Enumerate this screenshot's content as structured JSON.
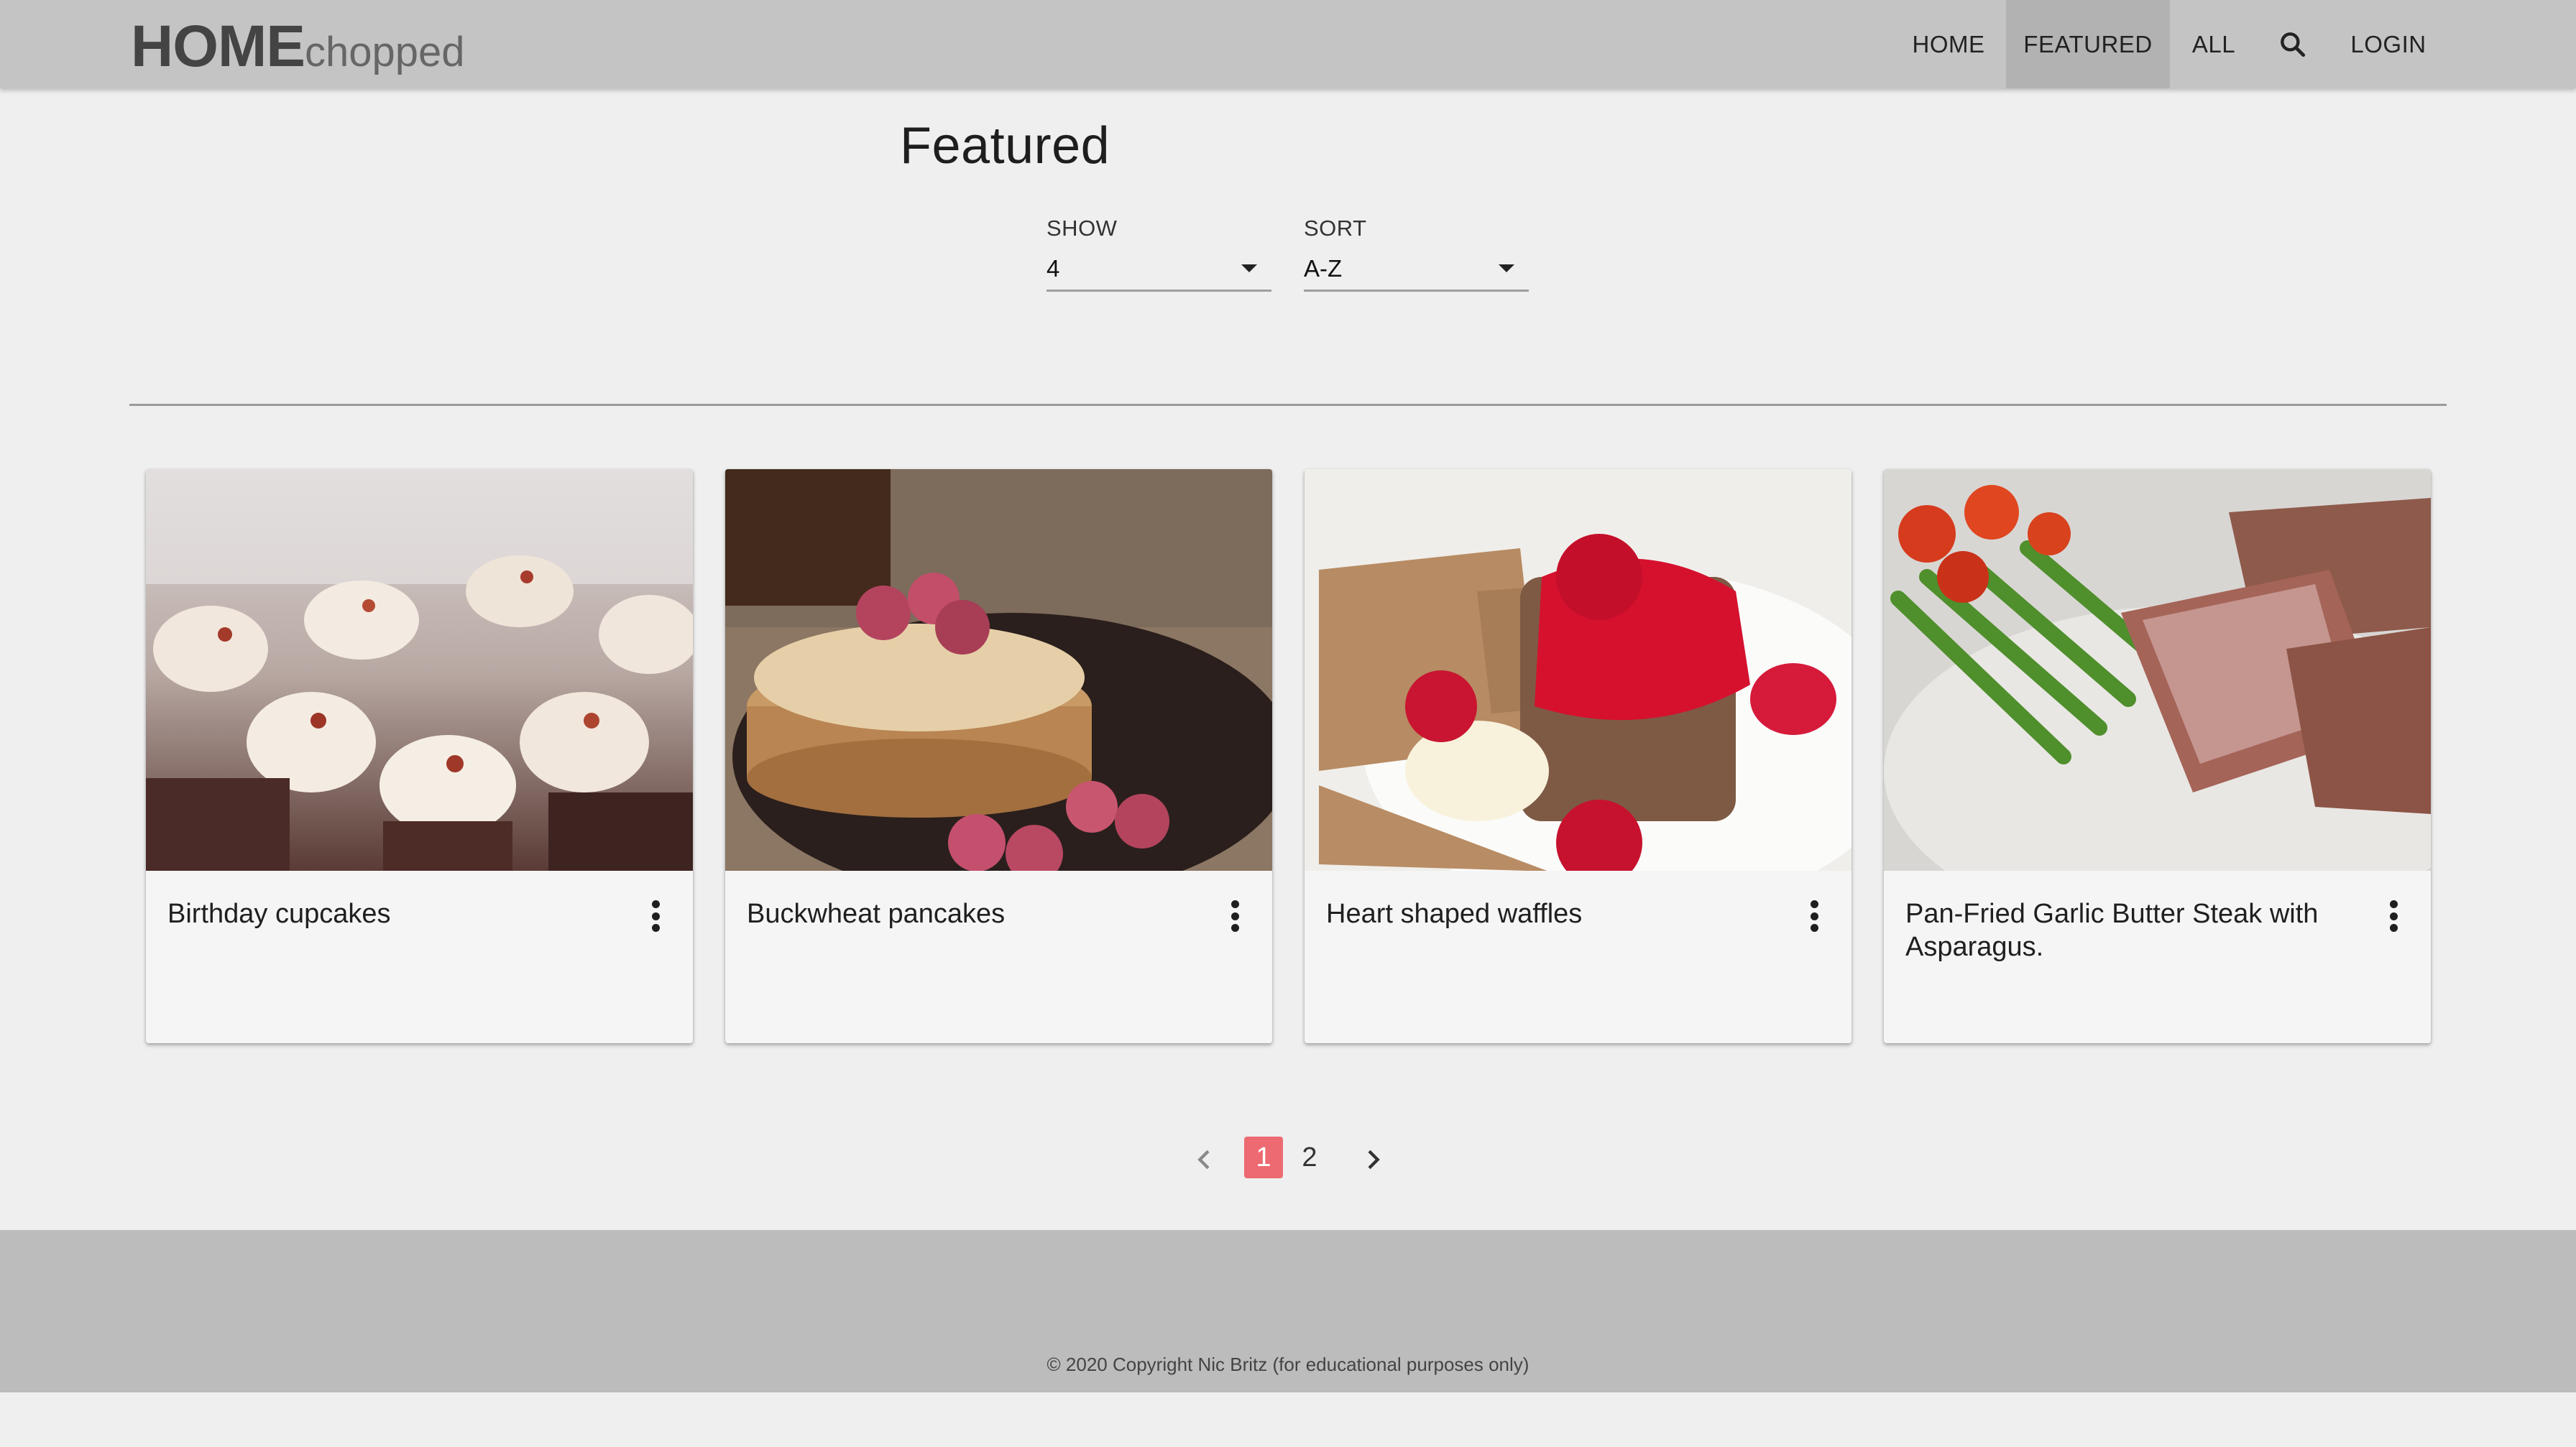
{
  "header": {
    "logo_bold": "HOME",
    "logo_light": "chopped",
    "nav": [
      {
        "label": "HOME",
        "active": false
      },
      {
        "label": "FEATURED",
        "active": true
      },
      {
        "label": "ALL",
        "active": false
      },
      {
        "icon": "search-icon"
      },
      {
        "label": "LOGIN",
        "active": false
      }
    ]
  },
  "main": {
    "title": "Featured",
    "filters": {
      "show": {
        "label": "SHOW",
        "value": "4"
      },
      "sort": {
        "label": "SORT",
        "value": "A-Z"
      }
    },
    "cards": [
      {
        "title": "Birthday cupcakes",
        "image": "cupcakes",
        "menu_icon": "more-vert-icon"
      },
      {
        "title": "Buckwheat pancakes",
        "image": "pancakes",
        "menu_icon": "more-vert-icon"
      },
      {
        "title": "Heart shaped waffles",
        "image": "waffles",
        "menu_icon": "more-vert-icon"
      },
      {
        "title": "Pan-Fried Garlic Butter Steak with Asparagus.",
        "image": "steak",
        "menu_icon": "more-vert-icon"
      }
    ],
    "pagination": {
      "pages": [
        "1",
        "2"
      ],
      "current": "1",
      "prev_icon": "chevron-left-icon",
      "next_icon": "chevron-right-icon"
    }
  },
  "footer": {
    "text": "© 2020 Copyright Nic Britz (for educational purposes only)"
  },
  "colors": {
    "header_bg": "#c4c4c4",
    "nav_active_bg": "#b2b2b2",
    "page_bg": "#efefef",
    "footer_bg": "#bcbcbc",
    "accent": "#ed6a72"
  }
}
